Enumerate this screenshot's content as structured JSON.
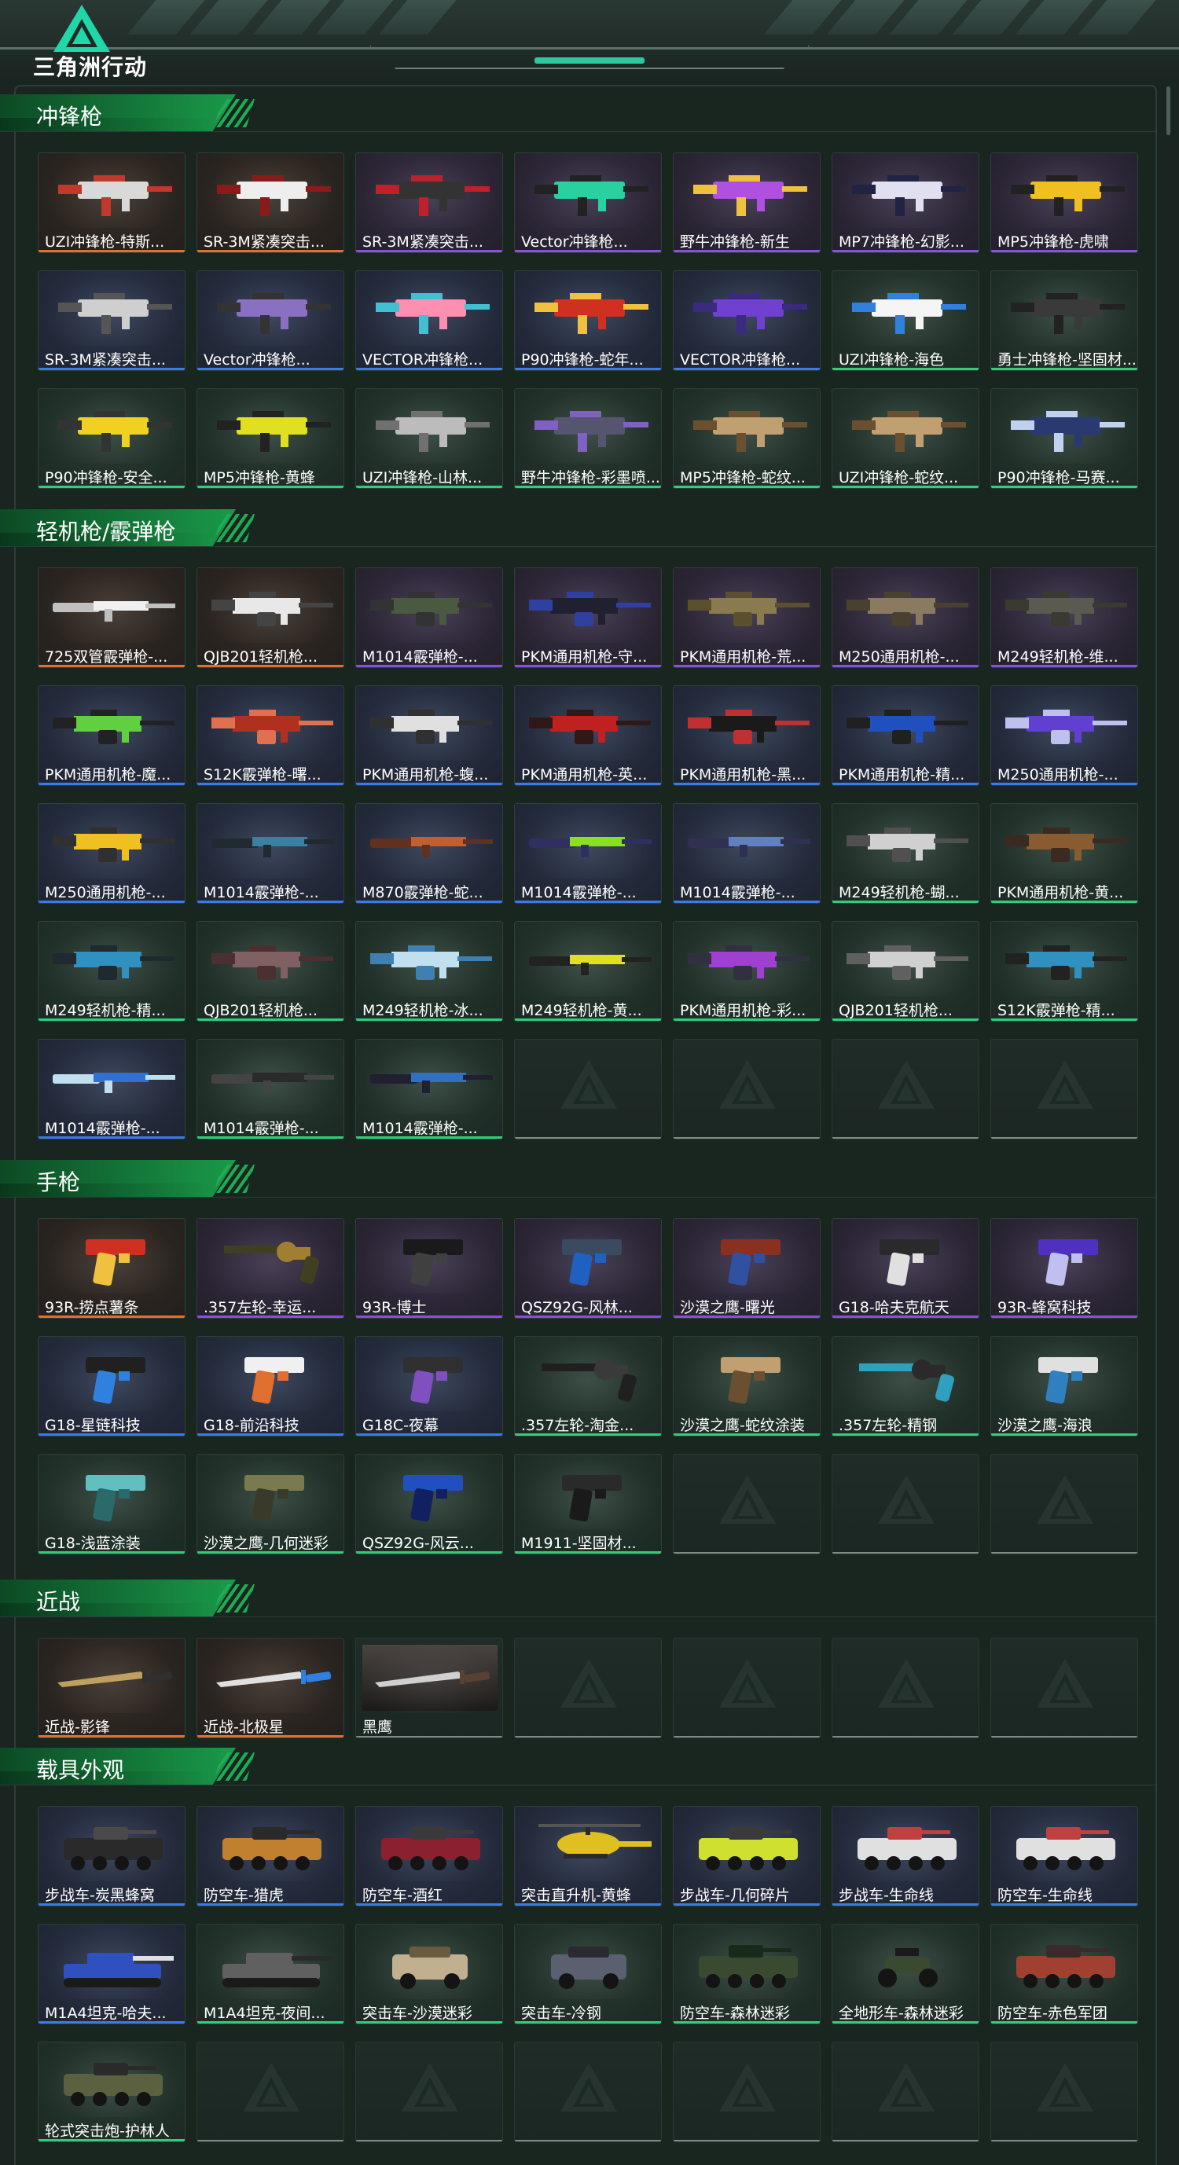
{
  "header": {
    "logo_text": "三角洲行动",
    "logo_icon": "delta-triangle-logo"
  },
  "sections": [
    {
      "title": "冲锋枪",
      "items": [
        {
          "name": "UZI冲锋枪-特斯...",
          "rarity": "orange",
          "kind": "smg",
          "colors": [
            "#d9d9d9",
            "#c0392b"
          ]
        },
        {
          "name": "SR-3M紧凑突击...",
          "rarity": "orange",
          "kind": "smg",
          "colors": [
            "#eeeeee",
            "#8b1a1a"
          ]
        },
        {
          "name": "SR-3M紧凑突击...",
          "rarity": "purple",
          "kind": "smg",
          "colors": [
            "#333333",
            "#c0202a"
          ]
        },
        {
          "name": "Vector冲锋枪...",
          "rarity": "purple",
          "kind": "smg",
          "colors": [
            "#2ad1a0",
            "#222222"
          ]
        },
        {
          "name": "野牛冲锋枪-新生",
          "rarity": "purple",
          "kind": "smg",
          "colors": [
            "#b050e0",
            "#f0c040"
          ]
        },
        {
          "name": "MP7冲锋枪-幻影...",
          "rarity": "purple",
          "kind": "smg",
          "colors": [
            "#e0e0f0",
            "#222244"
          ]
        },
        {
          "name": "MP5冲锋枪-虎啸",
          "rarity": "purple",
          "kind": "smg",
          "colors": [
            "#f0c020",
            "#222222"
          ]
        },
        {
          "name": "SR-3M紧凑突击...",
          "rarity": "blue",
          "kind": "smg",
          "colors": [
            "#cfcfcf",
            "#555555"
          ]
        },
        {
          "name": "Vector冲锋枪...",
          "rarity": "blue",
          "kind": "smg",
          "colors": [
            "#8a70c0",
            "#333333"
          ]
        },
        {
          "name": "VECTOR冲锋枪...",
          "rarity": "blue",
          "kind": "smg",
          "colors": [
            "#ff8fb0",
            "#40c0d0"
          ]
        },
        {
          "name": "P90冲锋枪-蛇年...",
          "rarity": "blue",
          "kind": "smg",
          "colors": [
            "#d03020",
            "#f0c040"
          ]
        },
        {
          "name": "VECTOR冲锋枪...",
          "rarity": "blue",
          "kind": "smg",
          "colors": [
            "#7040d0",
            "#3a2a80"
          ]
        },
        {
          "name": "UZI冲锋枪-海色",
          "rarity": "green",
          "kind": "smg",
          "colors": [
            "#f5f5f5",
            "#3080e0"
          ]
        },
        {
          "name": "勇士冲锋枪-坚固材...",
          "rarity": "green",
          "kind": "smg",
          "colors": [
            "#3a3a3a",
            "#222222"
          ]
        },
        {
          "name": "P90冲锋枪-安全...",
          "rarity": "green",
          "kind": "smg",
          "colors": [
            "#f0d020",
            "#333333"
          ]
        },
        {
          "name": "MP5冲锋枪-黄蜂",
          "rarity": "green",
          "kind": "smg",
          "colors": [
            "#e0e020",
            "#222222"
          ]
        },
        {
          "name": "UZI冲锋枪-山林...",
          "rarity": "green",
          "kind": "smg",
          "colors": [
            "#bcbcbc",
            "#707070"
          ]
        },
        {
          "name": "野牛冲锋枪-彩墨喷...",
          "rarity": "green",
          "kind": "smg",
          "colors": [
            "#555570",
            "#8060c0"
          ]
        },
        {
          "name": "MP5冲锋枪-蛇纹...",
          "rarity": "green",
          "kind": "smg",
          "colors": [
            "#c0a070",
            "#6a5030"
          ]
        },
        {
          "name": "UZI冲锋枪-蛇纹...",
          "rarity": "green",
          "kind": "smg",
          "colors": [
            "#c0a070",
            "#6a5030"
          ]
        },
        {
          "name": "P90冲锋枪-马赛...",
          "rarity": "green",
          "kind": "smg",
          "colors": [
            "#2a3a70",
            "#c0d0f0"
          ]
        }
      ]
    },
    {
      "title": "轻机枪/霰弹枪",
      "items": [
        {
          "name": "725双管霰弹枪-...",
          "rarity": "orange",
          "kind": "long",
          "colors": [
            "#f0f0f0",
            "#c0c0c0"
          ]
        },
        {
          "name": "QJB201轻机枪...",
          "rarity": "orange",
          "kind": "lmg",
          "colors": [
            "#e8e8e8",
            "#444444"
          ]
        },
        {
          "name": "M1014霰弹枪-...",
          "rarity": "purple",
          "kind": "lmg",
          "colors": [
            "#4a5a40",
            "#333333"
          ]
        },
        {
          "name": "PKM通用机枪-守...",
          "rarity": "purple",
          "kind": "lmg",
          "colors": [
            "#202030",
            "#3040a0"
          ]
        },
        {
          "name": "PKM通用机枪-荒...",
          "rarity": "purple",
          "kind": "lmg",
          "colors": [
            "#8a7a50",
            "#5a5030"
          ]
        },
        {
          "name": "M250通用机枪-...",
          "rarity": "purple",
          "kind": "lmg",
          "colors": [
            "#8a7a60",
            "#4a4030"
          ]
        },
        {
          "name": "M249轻机枪-维...",
          "rarity": "purple",
          "kind": "lmg",
          "colors": [
            "#5a5a50",
            "#3a3a30"
          ]
        },
        {
          "name": "PKM通用机枪-魔...",
          "rarity": "blue",
          "kind": "lmg",
          "colors": [
            "#60d040",
            "#222222"
          ]
        },
        {
          "name": "S12K霰弹枪-曙...",
          "rarity": "blue",
          "kind": "lmg",
          "colors": [
            "#b03020",
            "#e07050"
          ]
        },
        {
          "name": "PKM通用机枪-蝮...",
          "rarity": "blue",
          "kind": "lmg",
          "colors": [
            "#e0e0e0",
            "#303030"
          ]
        },
        {
          "name": "PKM通用机枪-英...",
          "rarity": "blue",
          "kind": "lmg",
          "colors": [
            "#c02020",
            "#301818"
          ]
        },
        {
          "name": "PKM通用机枪-黑...",
          "rarity": "blue",
          "kind": "lmg",
          "colors": [
            "#1a1a1a",
            "#c03030"
          ]
        },
        {
          "name": "PKM通用机枪-精...",
          "rarity": "blue",
          "kind": "lmg",
          "colors": [
            "#2050c0",
            "#202020"
          ]
        },
        {
          "name": "M250通用机枪-...",
          "rarity": "blue",
          "kind": "lmg",
          "colors": [
            "#6040d0",
            "#c0c0f0"
          ]
        },
        {
          "name": "M250通用机枪-...",
          "rarity": "blue",
          "kind": "lmg",
          "colors": [
            "#f0c020",
            "#303030"
          ]
        },
        {
          "name": "M1014霰弹枪-...",
          "rarity": "blue",
          "kind": "long",
          "colors": [
            "#3a80a0",
            "#202a30"
          ]
        },
        {
          "name": "M870霰弹枪-蛇...",
          "rarity": "blue",
          "kind": "long",
          "colors": [
            "#c06030",
            "#603020"
          ]
        },
        {
          "name": "M1014霰弹枪-...",
          "rarity": "blue",
          "kind": "long",
          "colors": [
            "#8ae020",
            "#303060"
          ]
        },
        {
          "name": "M1014霰弹枪-...",
          "rarity": "blue",
          "kind": "long",
          "colors": [
            "#6080c0",
            "#303050"
          ]
        },
        {
          "name": "M249轻机枪-蝴...",
          "rarity": "green",
          "kind": "lmg",
          "colors": [
            "#d0d0d0",
            "#505050"
          ]
        },
        {
          "name": "PKM通用机枪-黄...",
          "rarity": "green",
          "kind": "lmg",
          "colors": [
            "#8a5a30",
            "#3a2a20"
          ]
        },
        {
          "name": "M249轻机枪-精...",
          "rarity": "green",
          "kind": "lmg",
          "colors": [
            "#3090c0",
            "#202830"
          ]
        },
        {
          "name": "QJB201轻机枪...",
          "rarity": "green",
          "kind": "lmg",
          "colors": [
            "#806060",
            "#4a3030"
          ]
        },
        {
          "name": "M249轻机枪-冰...",
          "rarity": "green",
          "kind": "lmg",
          "colors": [
            "#c0e0f0",
            "#4080b0"
          ]
        },
        {
          "name": "M249轻机枪-黄...",
          "rarity": "green",
          "kind": "long",
          "colors": [
            "#e0e020",
            "#222222"
          ]
        },
        {
          "name": "PKM通用机枪-彩...",
          "rarity": "green",
          "kind": "lmg",
          "colors": [
            "#a040d0",
            "#303040"
          ]
        },
        {
          "name": "QJB201轻机枪...",
          "rarity": "green",
          "kind": "lmg",
          "colors": [
            "#d0d0d0",
            "#606060"
          ]
        },
        {
          "name": "S12K霰弹枪-精...",
          "rarity": "green",
          "kind": "lmg",
          "colors": [
            "#3090c0",
            "#222222"
          ]
        },
        {
          "name": "M1014霰弹枪-...",
          "rarity": "blue",
          "kind": "long",
          "colors": [
            "#3070d0",
            "#c0e0f0"
          ]
        },
        {
          "name": "M1014霰弹枪-...",
          "rarity": "green",
          "kind": "long",
          "colors": [
            "#2a2a2a",
            "#444444"
          ]
        },
        {
          "name": "M1014霰弹枪-...",
          "rarity": "green",
          "kind": "long",
          "colors": [
            "#3070c0",
            "#202030"
          ]
        },
        {
          "name": "",
          "rarity": "empty"
        },
        {
          "name": "",
          "rarity": "empty"
        },
        {
          "name": "",
          "rarity": "empty"
        },
        {
          "name": "",
          "rarity": "empty"
        }
      ]
    },
    {
      "title": "手枪",
      "items": [
        {
          "name": "93R-捞点薯条",
          "rarity": "orange",
          "kind": "pistol",
          "colors": [
            "#d03020",
            "#f0c040"
          ]
        },
        {
          "name": ".357左轮-幸运...",
          "rarity": "purple",
          "kind": "revolver",
          "colors": [
            "#a08030",
            "#404020"
          ]
        },
        {
          "name": "93R-博士",
          "rarity": "purple",
          "kind": "pistol",
          "colors": [
            "#1a1a1a",
            "#404040"
          ]
        },
        {
          "name": "QSZ92G-风林...",
          "rarity": "purple",
          "kind": "pistol",
          "colors": [
            "#3a4a60",
            "#2060c0"
          ]
        },
        {
          "name": "沙漠之鹰-曙光",
          "rarity": "purple",
          "kind": "pistol",
          "colors": [
            "#8a3020",
            "#3050a0"
          ]
        },
        {
          "name": "G18-哈夫克航天",
          "rarity": "purple",
          "kind": "pistol",
          "colors": [
            "#2a2a2a",
            "#e0e0e0"
          ]
        },
        {
          "name": "93R-蜂窝科技",
          "rarity": "purple",
          "kind": "pistol",
          "colors": [
            "#5030c0",
            "#c0c0f0"
          ]
        },
        {
          "name": "G18-星链科技",
          "rarity": "blue",
          "kind": "pistol",
          "colors": [
            "#202020",
            "#3080e0"
          ]
        },
        {
          "name": "G18-前沿科技",
          "rarity": "blue",
          "kind": "pistol",
          "colors": [
            "#f0f0f0",
            "#e07030"
          ]
        },
        {
          "name": "G18C-夜幕",
          "rarity": "blue",
          "kind": "pistol",
          "colors": [
            "#303030",
            "#8050c0"
          ]
        },
        {
          "name": ".357左轮-淘金...",
          "rarity": "green",
          "kind": "revolver",
          "colors": [
            "#3a3a3a",
            "#202020"
          ]
        },
        {
          "name": "沙漠之鹰-蛇纹涂装",
          "rarity": "green",
          "kind": "pistol",
          "colors": [
            "#c0a070",
            "#6a5030"
          ]
        },
        {
          "name": ".357左轮-精钢",
          "rarity": "green",
          "kind": "revolver",
          "colors": [
            "#2a2a2a",
            "#30a0c0"
          ]
        },
        {
          "name": "沙漠之鹰-海浪",
          "rarity": "green",
          "kind": "pistol",
          "colors": [
            "#e0e0e0",
            "#3080c0"
          ]
        },
        {
          "name": "G18-浅蓝涂装",
          "rarity": "green",
          "kind": "pistol",
          "colors": [
            "#60c0c0",
            "#2a6a6a"
          ]
        },
        {
          "name": "沙漠之鹰-几何迷彩",
          "rarity": "green",
          "kind": "pistol",
          "colors": [
            "#7a7a50",
            "#3a3a2a"
          ]
        },
        {
          "name": "QSZ92G-风云...",
          "rarity": "green",
          "kind": "pistol",
          "colors": [
            "#2050c0",
            "#102060"
          ]
        },
        {
          "name": "M1911-坚固材...",
          "rarity": "green",
          "kind": "pistol",
          "colors": [
            "#2a2a2a",
            "#1a1a1a"
          ]
        },
        {
          "name": "",
          "rarity": "empty"
        },
        {
          "name": "",
          "rarity": "empty"
        },
        {
          "name": "",
          "rarity": "empty"
        }
      ]
    },
    {
      "title": "近战",
      "items": [
        {
          "name": "近战-影锋",
          "rarity": "orange",
          "kind": "knife",
          "colors": [
            "#c0a060",
            "#303030"
          ]
        },
        {
          "name": "近战-北极星",
          "rarity": "orange",
          "kind": "knife",
          "colors": [
            "#e0e0e0",
            "#3080e0"
          ]
        },
        {
          "name": "黑鹰",
          "rarity": "empty",
          "kind": "knife",
          "colors": [
            "#d0d0d0",
            "#5a4030"
          ],
          "photo": true
        },
        {
          "name": "",
          "rarity": "empty"
        },
        {
          "name": "",
          "rarity": "empty"
        },
        {
          "name": "",
          "rarity": "empty"
        },
        {
          "name": "",
          "rarity": "empty"
        }
      ]
    },
    {
      "title": "载具外观",
      "items": [
        {
          "name": "步战车-炭黑蜂窝",
          "rarity": "blue",
          "kind": "apc",
          "colors": [
            "#2a2a2a",
            "#4a4a4a"
          ]
        },
        {
          "name": "防空车-猎虎",
          "rarity": "blue",
          "kind": "apc",
          "colors": [
            "#c08030",
            "#2a2a2a"
          ]
        },
        {
          "name": "防空车-酒红",
          "rarity": "blue",
          "kind": "apc",
          "colors": [
            "#8a2030",
            "#3a3a3a"
          ]
        },
        {
          "name": "突击直升机-黄蜂",
          "rarity": "blue",
          "kind": "heli",
          "colors": [
            "#e0c020",
            "#2a2a2a"
          ]
        },
        {
          "name": "步战车-几何碎片",
          "rarity": "blue",
          "kind": "apc",
          "colors": [
            "#d0e030",
            "#3a3a3a"
          ]
        },
        {
          "name": "步战车-生命线",
          "rarity": "blue",
          "kind": "apc",
          "colors": [
            "#e0e0e0",
            "#c04040"
          ]
        },
        {
          "name": "防空车-生命线",
          "rarity": "blue",
          "kind": "apc",
          "colors": [
            "#e0e0e0",
            "#c04040"
          ]
        },
        {
          "name": "M1A4坦克-哈夫...",
          "rarity": "blue",
          "kind": "tank",
          "colors": [
            "#3050c0",
            "#e0e0e0"
          ]
        },
        {
          "name": "M1A4坦克-夜间...",
          "rarity": "green",
          "kind": "tank",
          "colors": [
            "#606060",
            "#2a2a2a"
          ]
        },
        {
          "name": "突击车-沙漠迷彩",
          "rarity": "green",
          "kind": "car",
          "colors": [
            "#c0b090",
            "#6a5a40"
          ]
        },
        {
          "name": "突击车-冷钢",
          "rarity": "green",
          "kind": "car",
          "colors": [
            "#5a6070",
            "#2a2a30"
          ]
        },
        {
          "name": "防空车-森林迷彩",
          "rarity": "green",
          "kind": "apc",
          "colors": [
            "#3a4a30",
            "#1a2a1a"
          ]
        },
        {
          "name": "全地形车-森林迷彩",
          "rarity": "green",
          "kind": "atv",
          "colors": [
            "#3a4a30",
            "#1a1a1a"
          ]
        },
        {
          "name": "防空车-赤色军团",
          "rarity": "green",
          "kind": "apc",
          "colors": [
            "#a04030",
            "#3a2a2a"
          ]
        },
        {
          "name": "轮式突击炮-护林人",
          "rarity": "green",
          "kind": "apc",
          "colors": [
            "#5a6040",
            "#2a2a2a"
          ]
        },
        {
          "name": "",
          "rarity": "empty"
        },
        {
          "name": "",
          "rarity": "empty"
        },
        {
          "name": "",
          "rarity": "empty"
        },
        {
          "name": "",
          "rarity": "empty"
        },
        {
          "name": "",
          "rarity": "empty"
        },
        {
          "name": "",
          "rarity": "empty"
        }
      ]
    }
  ]
}
